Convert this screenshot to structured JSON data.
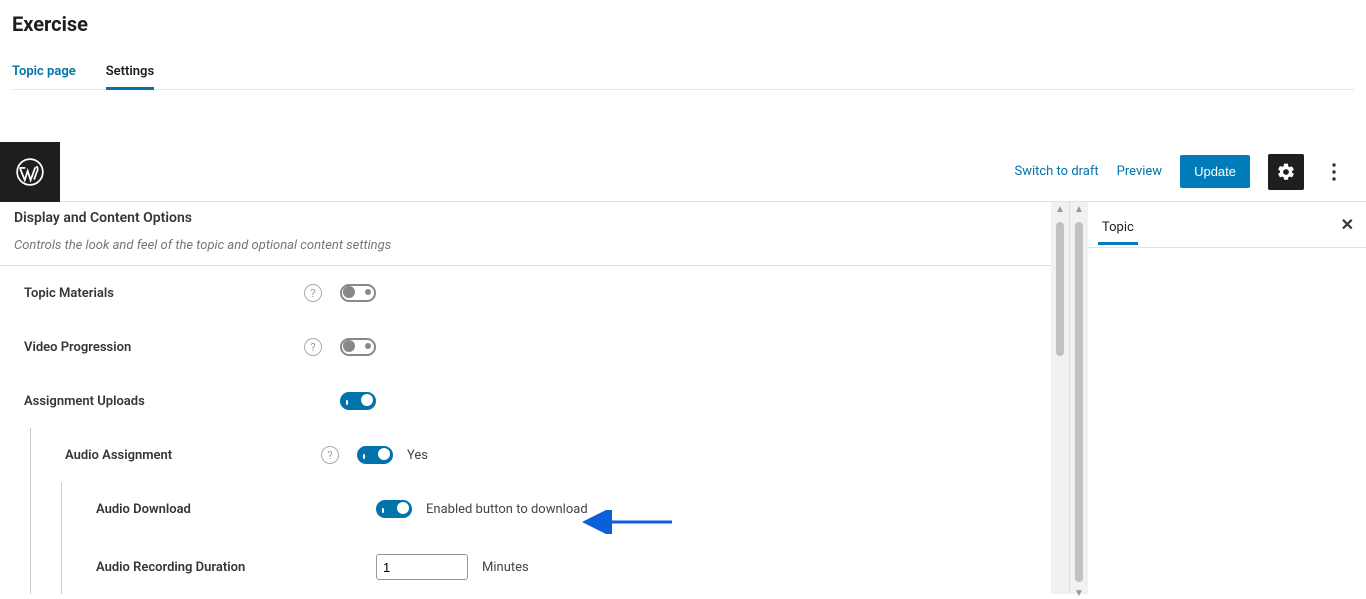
{
  "page_title": "Exercise",
  "top_tabs": {
    "topic_page": "Topic page",
    "settings": "Settings"
  },
  "wp_bar": {
    "switch_draft": "Switch to draft",
    "preview": "Preview",
    "update": "Update"
  },
  "section": {
    "heading": "Display and Content Options",
    "description": "Controls the look and feel of the topic and optional content settings"
  },
  "options": {
    "topic_materials": {
      "label": "Topic Materials",
      "has_help": true,
      "on": false
    },
    "video_progression": {
      "label": "Video Progression",
      "has_help": true,
      "on": false
    },
    "assignment_uploads": {
      "label": "Assignment Uploads",
      "has_help": false,
      "on": true
    },
    "audio_assignment": {
      "label": "Audio Assignment",
      "has_help": true,
      "on": true,
      "desc": "Yes"
    },
    "audio_download": {
      "label": "Audio Download",
      "has_help": false,
      "on": true,
      "desc": "Enabled button to download"
    },
    "audio_recording_duration": {
      "label": "Audio Recording Duration",
      "value": "1",
      "unit": "Minutes"
    }
  },
  "right_panel": {
    "topic": "Topic"
  }
}
